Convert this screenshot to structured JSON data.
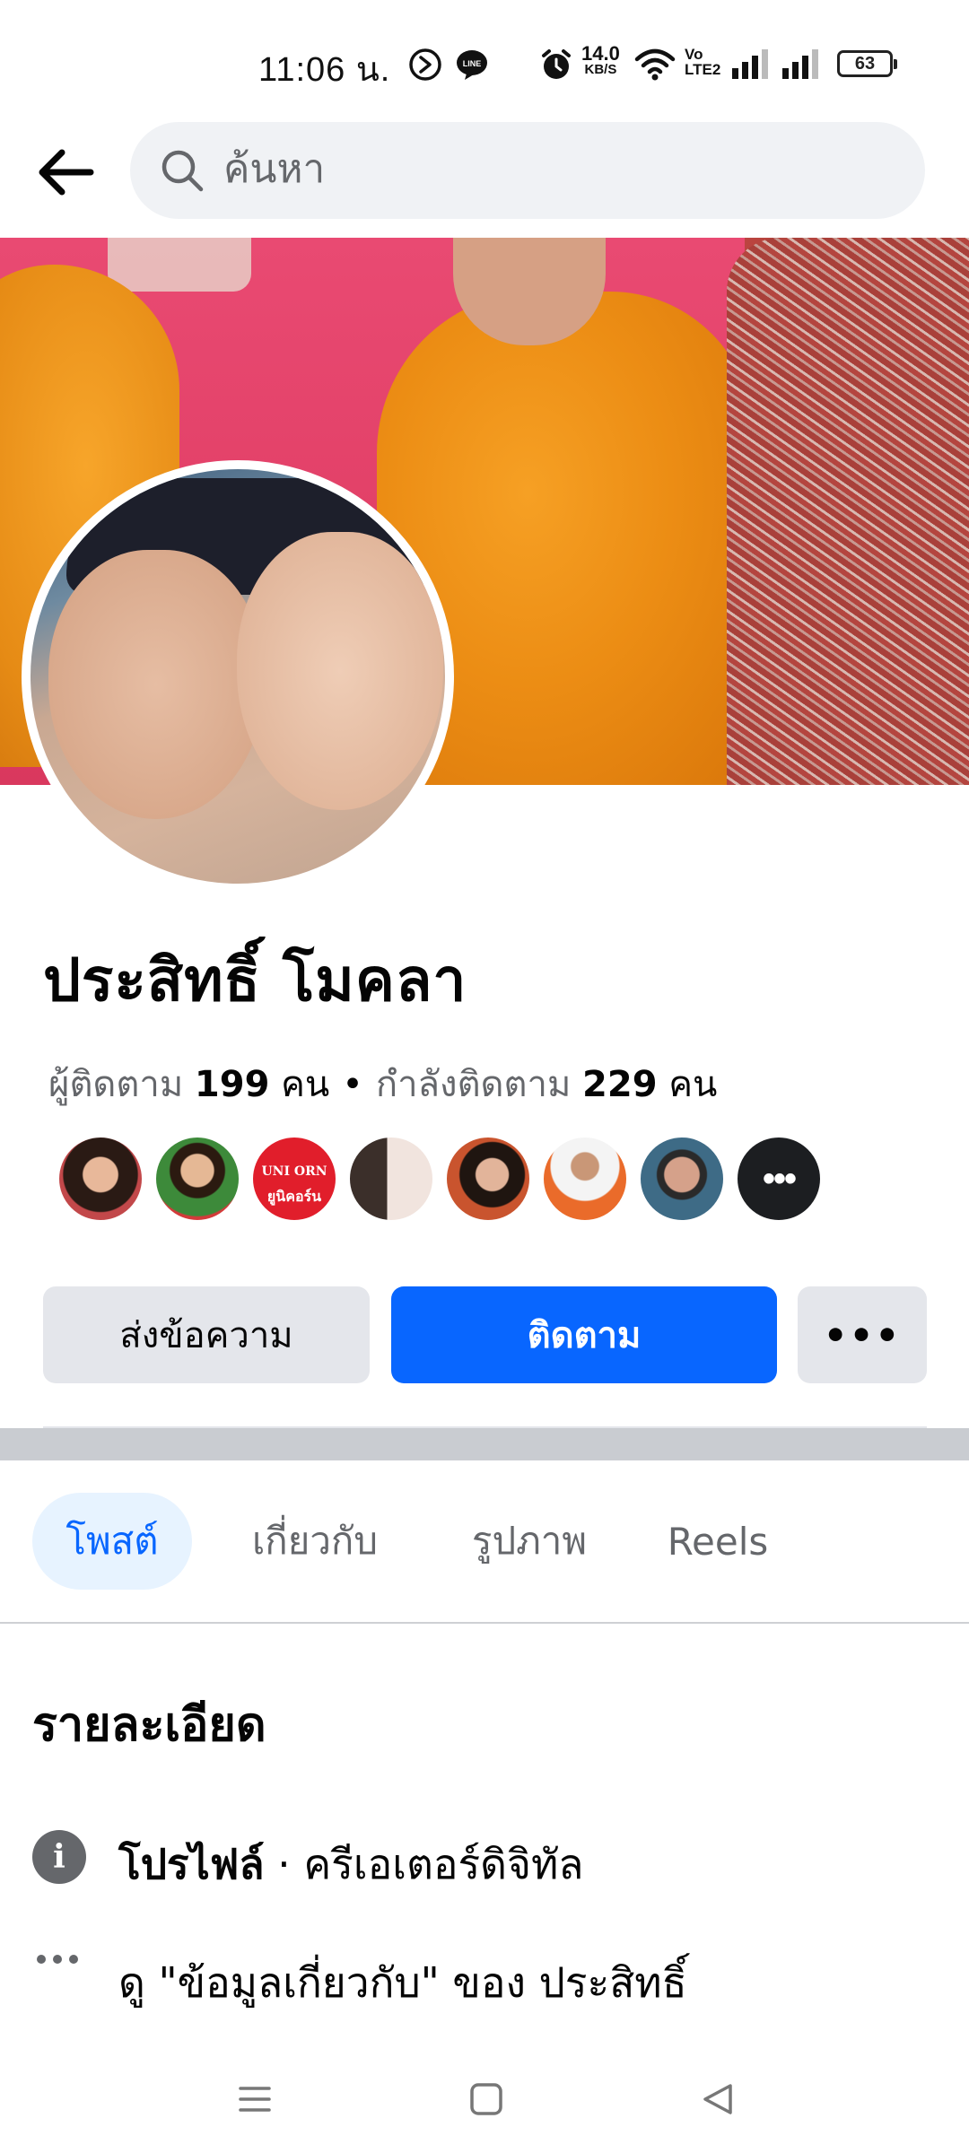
{
  "status_bar": {
    "time": "11:06 น.",
    "net_speed_value": "14.0",
    "net_speed_unit": "KB/S",
    "volte_top": "Vo",
    "volte_bottom": "LTE2",
    "battery": "63",
    "icons": [
      "app-indicator-icon",
      "line-icon",
      "alarm-icon",
      "wifi-icon",
      "signal-icon",
      "signal-icon-2"
    ]
  },
  "topbar": {
    "search_placeholder": "ค้นหา"
  },
  "profile": {
    "name": "ประสิทธิ์ โมคลา",
    "followers_label": "ผู้ติดตาม",
    "followers_count": "199",
    "followers_unit": "คน",
    "separator": "•",
    "following_label": "กำลังติดตาม",
    "following_count": "229",
    "following_unit": "คน"
  },
  "mutual_friends": {
    "unicorn_top": "UNI ORN",
    "unicorn_bottom": "ยูนิคอร์น",
    "more": "•••"
  },
  "actions": {
    "message_label": "ส่งข้อความ",
    "follow_label": "ติดตาม",
    "more_label": "•••"
  },
  "tabs": [
    {
      "label": "โพสต์",
      "active": true
    },
    {
      "label": "เกี่ยวกับ",
      "active": false
    },
    {
      "label": "รูปภาพ",
      "active": false
    },
    {
      "label": "Reels",
      "active": false
    }
  ],
  "details": {
    "title": "รายละเอียด",
    "profile_label": "โปรไฟล์",
    "profile_dot": " · ",
    "profile_category": "ครีเอเตอร์ดิจิทัล",
    "see_about": "ดู \"ข้อมูลเกี่ยวกับ\" ของ ประสิทธิ์"
  },
  "colors": {
    "accent": "#0866ff",
    "active_tab_bg": "#e7f3ff",
    "secondary_btn": "#e4e6eb",
    "muted_text": "#65676b"
  }
}
